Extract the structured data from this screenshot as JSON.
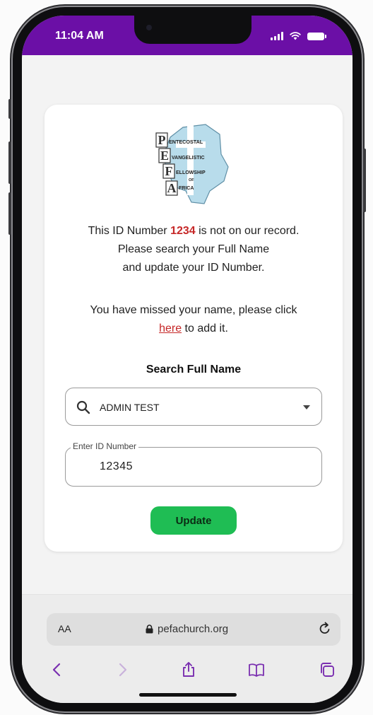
{
  "status": {
    "time": "11:04 AM",
    "bar_color": "#6b0fa6",
    "icons": [
      "signal-icon",
      "wifi-icon",
      "battery-icon"
    ]
  },
  "logo": {
    "alt": "PEFA",
    "lines": [
      "ENTECOSTAL",
      "VANGELISTIC",
      "ELLOWSHIP",
      "OF",
      "FRICA"
    ]
  },
  "notice": {
    "prefix": "This ID Number ",
    "id_number": "1234",
    "suffix": " is not on our record.",
    "line2": "Please search your Full Name",
    "line3": "and update your ID Number."
  },
  "missed": {
    "line1": "You have missed your name, please click",
    "link": "here",
    "suffix": " to add it."
  },
  "search": {
    "title": "Search Full Name",
    "value": "ADMIN TEST"
  },
  "id_field": {
    "legend": "Enter ID Number",
    "value": "12345"
  },
  "update_button": "Update",
  "accent_color": "#1fbd54",
  "browser": {
    "aa": "AA",
    "url": "pefachurch.org",
    "toolbar": [
      "back-icon",
      "forward-icon",
      "share-icon",
      "bookmarks-icon",
      "tabs-icon"
    ]
  }
}
